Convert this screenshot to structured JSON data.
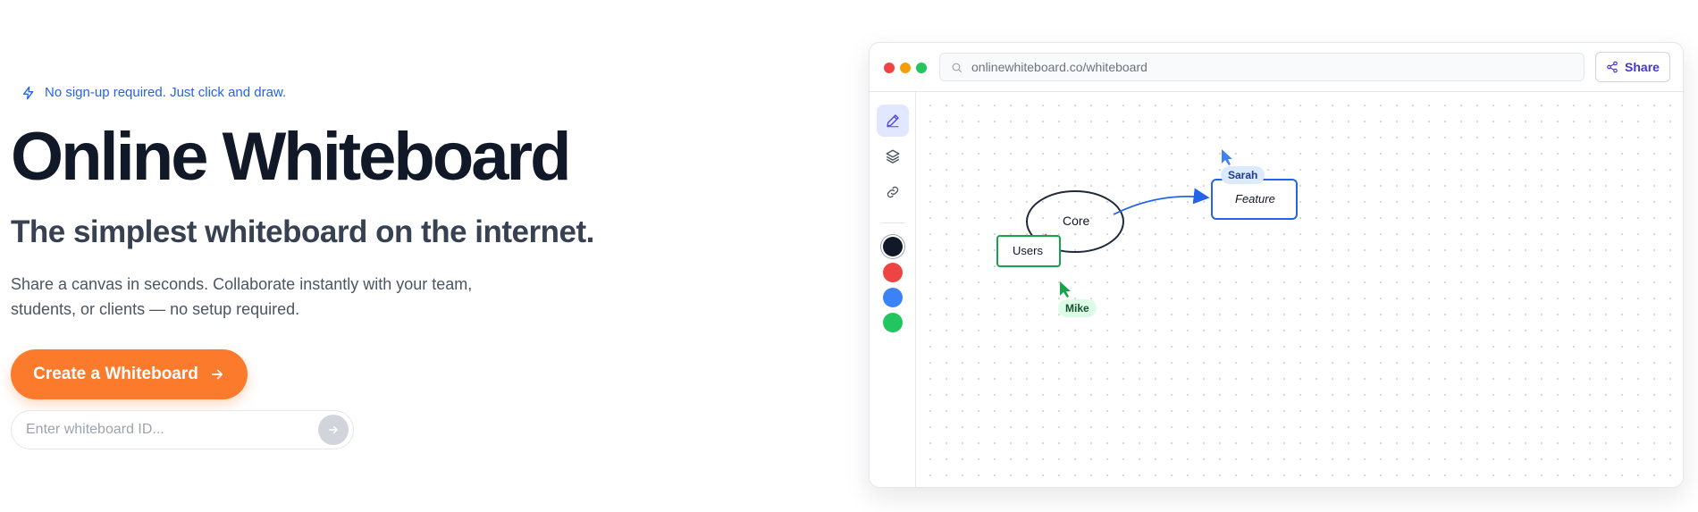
{
  "hero": {
    "tagline": "No sign-up required. Just click and draw.",
    "title": "Online Whiteboard",
    "subtitle": "The simplest whiteboard on the internet.",
    "description": "Share a canvas in seconds. Collaborate instantly with your team, students, or clients — no setup required.",
    "cta_label": "Create a Whiteboard",
    "id_input": {
      "placeholder": "Enter whiteboard ID...",
      "value": ""
    },
    "icons": {
      "tagline": "lightning-icon",
      "cta": "arrow-right-icon",
      "go": "arrow-right-icon"
    }
  },
  "window": {
    "url": "onlinewhiteboard.co/whiteboard",
    "share_label": "Share",
    "tools": [
      {
        "name": "pen",
        "icon": "pen-icon",
        "active": true
      },
      {
        "name": "layers",
        "icon": "layers-icon",
        "active": false
      },
      {
        "name": "link",
        "icon": "link-icon",
        "active": false
      }
    ],
    "colors": [
      "#111827",
      "#ef4444",
      "#3b82f6",
      "#22c55e"
    ],
    "selected_color": "#111827"
  },
  "board": {
    "shapes": [
      {
        "type": "ellipse",
        "label": "Core",
        "stroke": "#1f2937"
      },
      {
        "type": "rect",
        "label": "Users",
        "stroke": "#16a34a"
      },
      {
        "type": "rect",
        "label": "Feature",
        "stroke": "#2563eb"
      }
    ],
    "cursors": [
      {
        "name": "Sarah",
        "color": "#3b82f6",
        "badge_bg": "#dbeafe",
        "badge_text": "#1e3a8a"
      },
      {
        "name": "Mike",
        "color": "#16a34a",
        "badge_bg": "#dcfce7",
        "badge_text": "#14532d"
      }
    ]
  },
  "colors": {
    "accent": "#fb7a2c",
    "brand_link": "#2563eb",
    "share_text": "#4338ca"
  }
}
